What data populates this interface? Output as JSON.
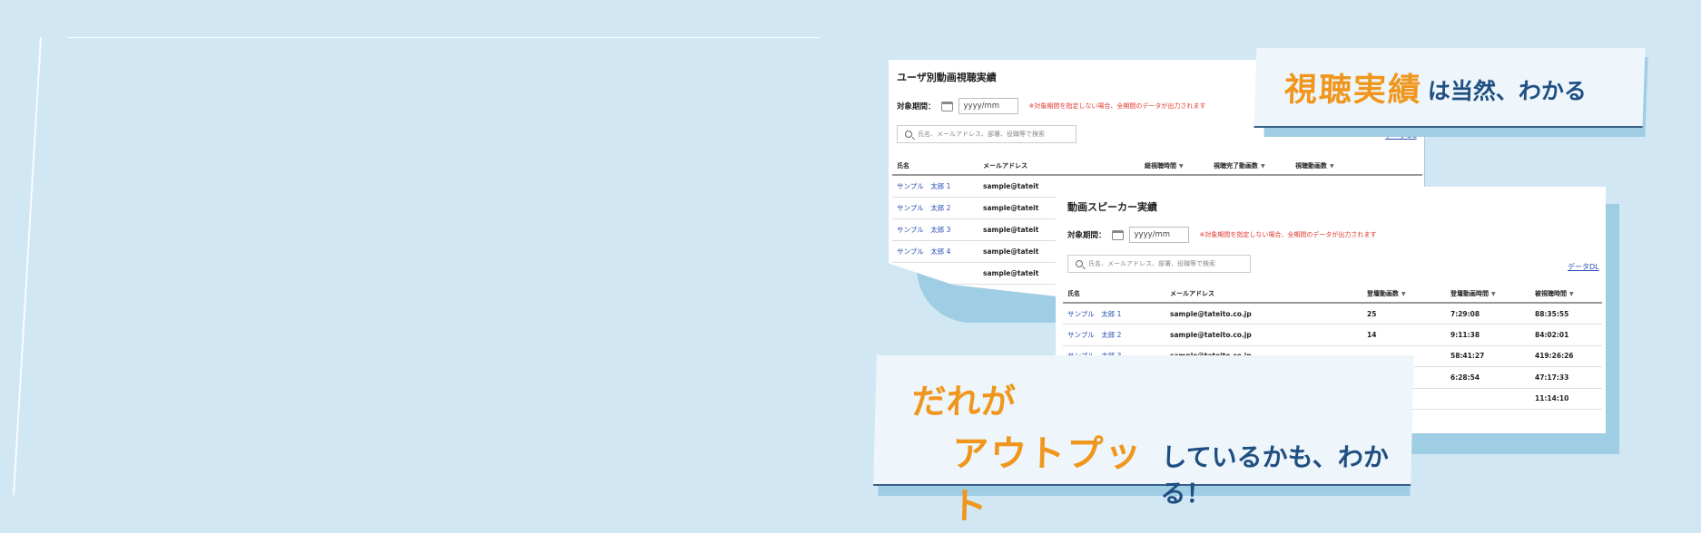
{
  "panel_user": {
    "title": "ユーザ別動画視聴実績",
    "period_label": "対象期間：",
    "date_placeholder": "yyyy/mm",
    "note": "※対象期間を指定しない場合、全期間のデータが出力されます",
    "search_placeholder": "氏名、メールアドレス、部署、役職等で検索",
    "download_label": "データDL",
    "columns": [
      "氏名",
      "メールアドレス",
      "総視聴時間",
      "視聴完了動画数",
      "視聴動画数"
    ],
    "rows": [
      {
        "name": "サンプル　太郎 1",
        "email": "sample@tateit"
      },
      {
        "name": "サンプル　太郎 2",
        "email": "sample@tateit"
      },
      {
        "name": "サンプル　太郎 3",
        "email": "sample@tateit"
      },
      {
        "name": "サンプル　太郎 4",
        "email": "sample@tateit"
      },
      {
        "name": "",
        "email": "sample@tateit"
      }
    ]
  },
  "panel_speaker": {
    "title": "動画スピーカー実績",
    "period_label": "対象期間：",
    "date_placeholder": "yyyy/mm",
    "note": "※対象期間を指定しない場合、全期間のデータが出力されます",
    "search_placeholder": "氏名、メールアドレス、部署、役職等で検索",
    "download_label": "データDL",
    "columns": [
      "氏名",
      "メールアドレス",
      "登壇動画数",
      "登壇動画時間",
      "被視聴時間"
    ],
    "rows": [
      {
        "name": "サンプル　太郎 1",
        "email": "sample@tateito.co.jp",
        "count": "25",
        "duration": "7:29:08",
        "watched": "88:35:55"
      },
      {
        "name": "サンプル　太郎 2",
        "email": "sample@tateito.co.jp",
        "count": "14",
        "duration": "9:11:38",
        "watched": "84:02:01"
      },
      {
        "name": "サンプル　太郎 3",
        "email": "sample@tateito.co.jp",
        "count": "",
        "duration": "58:41:27",
        "watched": "419:26:26"
      },
      {
        "name": "",
        "email": "",
        "count": "",
        "duration": "6:28:54",
        "watched": "47:17:33"
      },
      {
        "name": "",
        "email": "",
        "count": "",
        "duration": "",
        "watched": "11:14:10"
      }
    ]
  },
  "callout_top": {
    "highlight": "視聴実績",
    "rest": "は当然、わかる"
  },
  "callout_bottom": {
    "line1": "だれが",
    "highlight": "アウトプット",
    "rest": "しているかも、わかる！"
  },
  "colors": {
    "background": "#d1e7f4",
    "accent_orange": "#f0961c",
    "accent_navy": "#1f4f82",
    "link_blue": "#2a4fb5",
    "note_red": "#e0382e"
  }
}
